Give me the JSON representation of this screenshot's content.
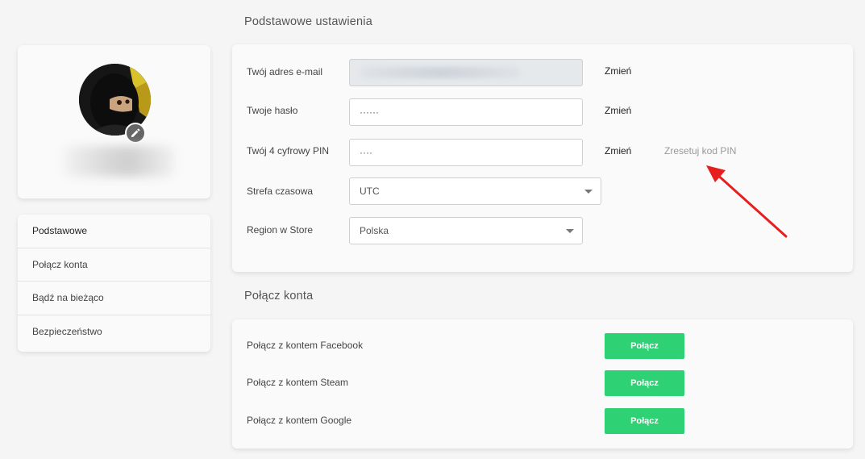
{
  "profile": {
    "edit_icon": "pencil-icon"
  },
  "nav": {
    "items": [
      {
        "label": "Podstawowe",
        "active": true
      },
      {
        "label": "Połącz konta",
        "active": false
      },
      {
        "label": "Bądź na bieżąco",
        "active": false
      },
      {
        "label": "Bezpieczeństwo",
        "active": false
      }
    ]
  },
  "basic": {
    "title": "Podstawowe ustawienia",
    "email": {
      "label": "Twój adres e-mail",
      "value": "",
      "change": "Zmień"
    },
    "password": {
      "label": "Twoje hasło",
      "value": "······",
      "change": "Zmień"
    },
    "pin": {
      "label": "Twój 4 cyfrowy PIN",
      "value": "····",
      "change": "Zmień",
      "reset": "Zresetuj kod PIN"
    },
    "timezone": {
      "label": "Strefa czasowa",
      "value": "UTC"
    },
    "region": {
      "label": "Region w Store",
      "value": "Polska"
    }
  },
  "connect": {
    "title": "Połącz konta",
    "items": [
      {
        "label": "Połącz z kontem Facebook",
        "button": "Połącz"
      },
      {
        "label": "Połącz z kontem Steam",
        "button": "Połącz"
      },
      {
        "label": "Połącz z kontem Google",
        "button": "Połącz"
      }
    ]
  },
  "colors": {
    "accent_green": "#2ed173",
    "annotation_arrow": "#e81e1e"
  }
}
